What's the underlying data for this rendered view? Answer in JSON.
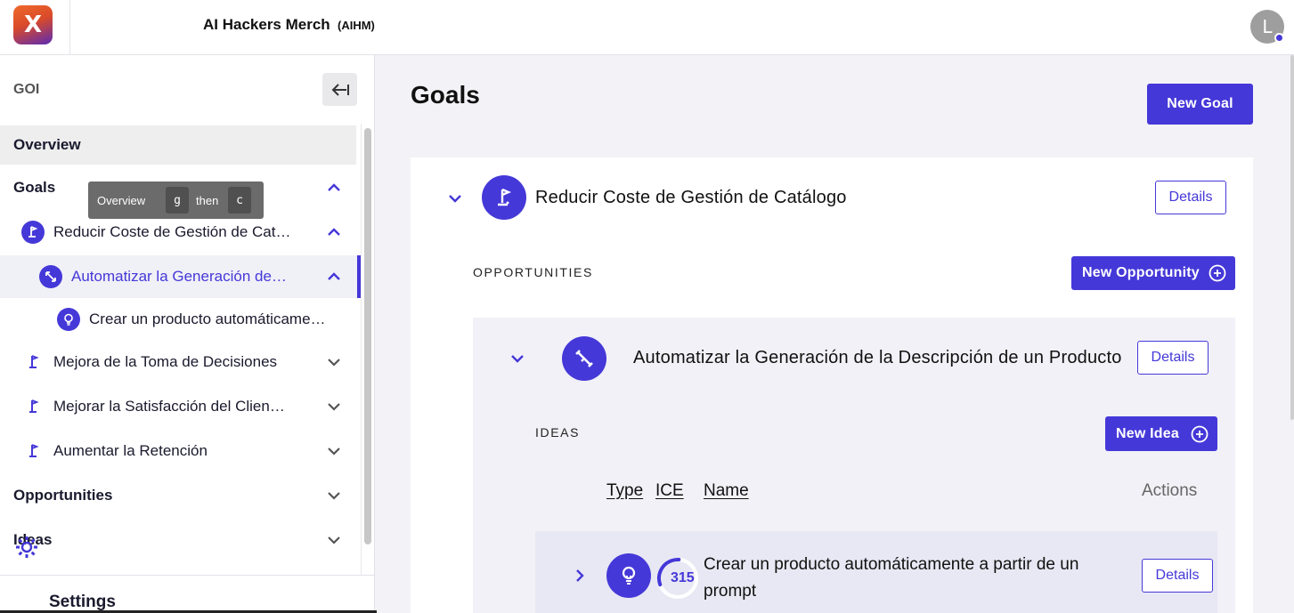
{
  "topbar": {
    "logo_letter": "X",
    "org_name": "AI Hackers Merch",
    "org_code": "(AIHM)",
    "avatar_initial": "L"
  },
  "sidebar": {
    "section_label": "GOI",
    "overview_label": "Overview",
    "goals_label": "Goals",
    "goals": [
      {
        "label": "Reducir Coste de Gestión de Cat…"
      },
      {
        "label": "Mejora de la Toma de Decisiones"
      },
      {
        "label": "Mejorar la Satisfacción del Clien…"
      },
      {
        "label": "Aumentar la Retención"
      }
    ],
    "selected_opportunity": "Automatizar la Generación de…",
    "idea_item": "Crear un producto automáticame…",
    "opportunities_label": "Opportunities",
    "ideas_label": "Ideas",
    "settings_label": "Settings"
  },
  "tooltip": {
    "label": "Overview",
    "key1": "g",
    "then": "then",
    "key2": "c"
  },
  "main": {
    "title": "Goals",
    "new_goal": "New Goal",
    "goal": {
      "title": "Reducir Coste de Gestión de Catálogo",
      "details": "Details"
    },
    "opportunities_label": "OPPORTUNITIES",
    "new_opportunity": "New Opportunity",
    "opportunity": {
      "title": "Automatizar la Generación de la Descripción de un Producto",
      "details": "Details"
    },
    "ideas_label": "IDEAS",
    "new_idea": "New Idea",
    "columns": {
      "type": "Type",
      "ice": "ICE",
      "name": "Name",
      "actions": "Actions"
    },
    "idea": {
      "ice": "315",
      "ice_fraction": 0.315,
      "name": "Crear un producto automáticamente a partir de un prompt",
      "details": "Details"
    }
  },
  "colors": {
    "accent": "#4538d8",
    "panel": "#f1f1f7"
  }
}
